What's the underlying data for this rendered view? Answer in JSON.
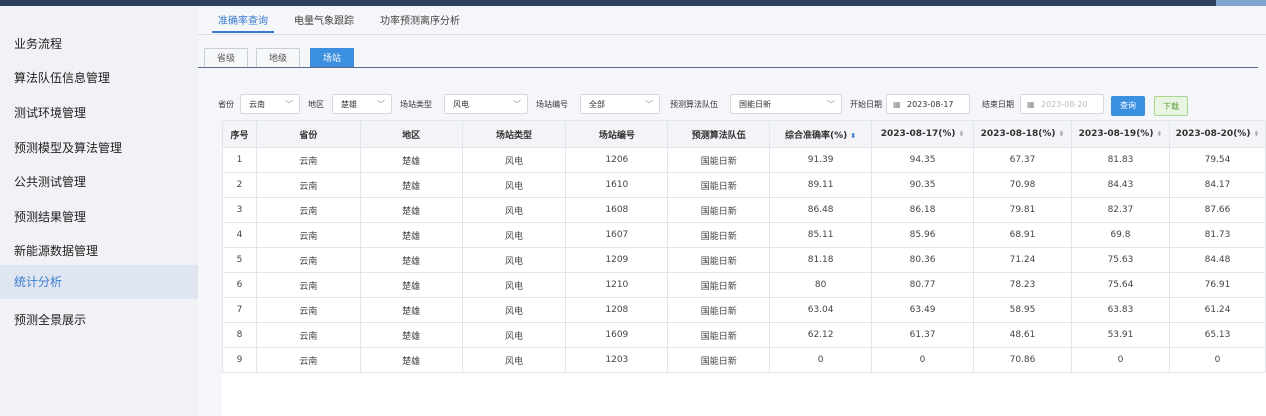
{
  "sidebar": {
    "items": [
      {
        "label": "业务流程"
      },
      {
        "label": "算法队伍信息管理"
      },
      {
        "label": "测试环境管理"
      },
      {
        "label": "预测模型及算法管理"
      },
      {
        "label": "公共测试管理"
      },
      {
        "label": "预测结果管理"
      },
      {
        "label": "新能源数据管理"
      },
      {
        "label": "统计分析"
      },
      {
        "label": "预测全景展示"
      }
    ],
    "active_index": 7
  },
  "main_tabs": [
    "准确率查询",
    "电量气象跟踪",
    "功率预测离序分析"
  ],
  "level_tabs": [
    "省级",
    "地级",
    "场站"
  ],
  "filters": {
    "province": {
      "label": "省份",
      "value": "云南"
    },
    "region": {
      "label": "地区",
      "value": "楚雄"
    },
    "station_type": {
      "label": "场站类型",
      "value": "风电"
    },
    "station_code": {
      "label": "场站编号",
      "value": "全部"
    },
    "team": {
      "label": "预测算法队伍",
      "value": "国能日新"
    },
    "start_date": {
      "label": "开始日期",
      "value": "2023-08-17"
    },
    "end_date": {
      "label": "结束日期",
      "placeholder": "2023-08-20"
    },
    "query_label": "查询",
    "download_label": "下载"
  },
  "table": {
    "headers": [
      "序号",
      "省份",
      "地区",
      "场站类型",
      "场站编号",
      "预测算法队伍",
      "综合准确率(%)",
      "2023-08-17(%)",
      "2023-08-18(%)",
      "2023-08-19(%)",
      "2023-08-20(%)"
    ],
    "rows": [
      [
        "1",
        "云南",
        "楚雄",
        "风电",
        "1206",
        "国能日新",
        "91.39",
        "94.35",
        "67.37",
        "81.83",
        "79.54"
      ],
      [
        "2",
        "云南",
        "楚雄",
        "风电",
        "1610",
        "国能日新",
        "89.11",
        "90.35",
        "70.98",
        "84.43",
        "84.17"
      ],
      [
        "3",
        "云南",
        "楚雄",
        "风电",
        "1608",
        "国能日新",
        "86.48",
        "86.18",
        "79.81",
        "82.37",
        "87.66"
      ],
      [
        "4",
        "云南",
        "楚雄",
        "风电",
        "1607",
        "国能日新",
        "85.11",
        "85.96",
        "68.91",
        "69.8",
        "81.73"
      ],
      [
        "5",
        "云南",
        "楚雄",
        "风电",
        "1209",
        "国能日新",
        "81.18",
        "80.36",
        "71.24",
        "75.63",
        "84.48"
      ],
      [
        "6",
        "云南",
        "楚雄",
        "风电",
        "1210",
        "国能日新",
        "80",
        "80.77",
        "78.23",
        "75.64",
        "76.91"
      ],
      [
        "7",
        "云南",
        "楚雄",
        "风电",
        "1208",
        "国能日新",
        "63.04",
        "63.49",
        "58.95",
        "63.83",
        "61.24"
      ],
      [
        "8",
        "云南",
        "楚雄",
        "风电",
        "1609",
        "国能日新",
        "62.12",
        "61.37",
        "48.61",
        "53.91",
        "65.13"
      ],
      [
        "9",
        "云南",
        "楚雄",
        "风电",
        "1203",
        "国能日新",
        "0",
        "0",
        "70.86",
        "0",
        "0"
      ]
    ]
  },
  "colors": {
    "accent": "#3b8fdf",
    "sidebar_active_bg": "#dfe6f1",
    "header_bg": "#2d3f5c"
  }
}
